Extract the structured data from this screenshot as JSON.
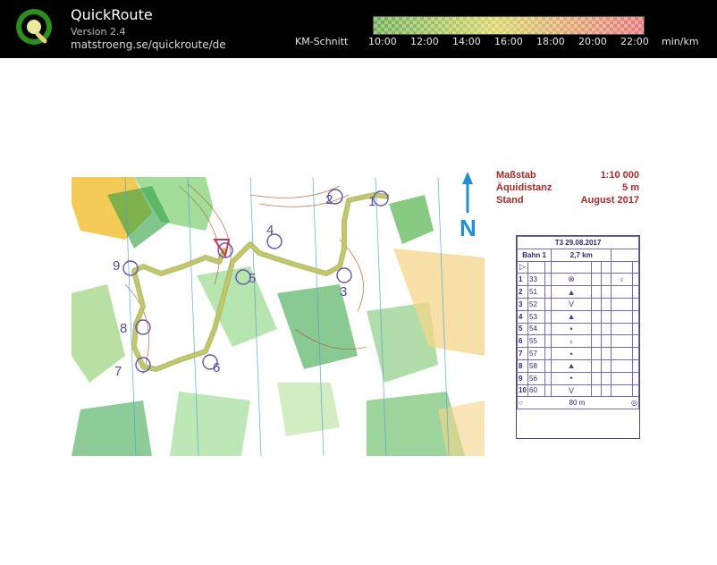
{
  "app": {
    "title": "QuickRoute",
    "version": "Version 2.4",
    "url": "matstroeng.se/quickroute/de"
  },
  "legend": {
    "label": "KM-Schnitt",
    "ticks": [
      "10:00",
      "12:00",
      "14:00",
      "16:00",
      "18:00",
      "20:00",
      "22:00"
    ],
    "unit": "min/km",
    "color_start": "#3f9f2f",
    "color_mid": "#d9d04a",
    "color_end": "#e25a4a"
  },
  "map_info": {
    "scale_label": "Maßstab",
    "scale_value": "1:10 000",
    "contour_label": "Äquidistanz",
    "contour_value": "5 m",
    "date_label": "Stand",
    "date_value": "August 2017"
  },
  "north_symbol": "N",
  "control_card": {
    "event": "T3 29.08.2017",
    "course": "Bahn 1",
    "length": "2,7 km",
    "start_symbol": "▷",
    "rows": [
      {
        "n": "1",
        "code": "33",
        "symbol": "⊗",
        "extra": "♀"
      },
      {
        "n": "2",
        "code": "51",
        "symbol": "▲",
        "extra": ""
      },
      {
        "n": "3",
        "code": "52",
        "symbol": "V",
        "extra": ""
      },
      {
        "n": "4",
        "code": "53",
        "symbol": "▲",
        "extra": ""
      },
      {
        "n": "5",
        "code": "54",
        "symbol": "•",
        "extra": ""
      },
      {
        "n": "6",
        "code": "55",
        "symbol": "♁",
        "extra": ""
      },
      {
        "n": "7",
        "code": "57",
        "symbol": "•",
        "extra": ""
      },
      {
        "n": "8",
        "code": "58",
        "symbol": "▲",
        "extra": ""
      },
      {
        "n": "9",
        "code": "56",
        "symbol": "•",
        "extra": ""
      },
      {
        "n": "10",
        "code": "60",
        "symbol": "V",
        "extra": ""
      }
    ],
    "finish_distance": "80 m"
  },
  "controls_on_map": [
    "1",
    "2",
    "3",
    "4",
    "5",
    "6",
    "7",
    "8",
    "9"
  ]
}
